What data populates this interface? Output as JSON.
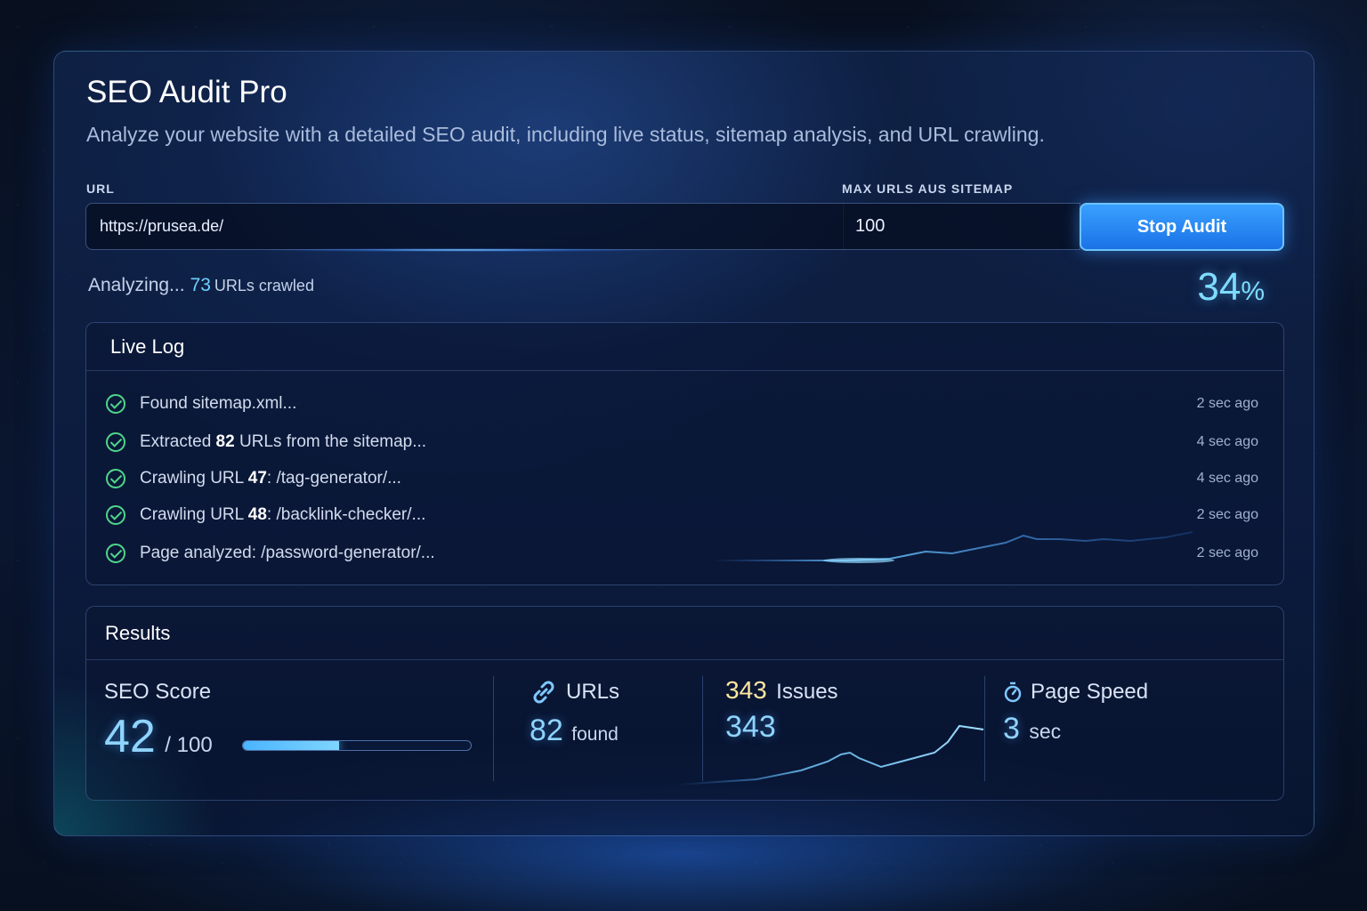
{
  "app": {
    "title": "SEO Audit Pro",
    "subtitle": "Analyze your website with a detailed SEO audit, including live status, sitemap analysis, and URL crawling."
  },
  "form": {
    "url_label": "URL",
    "url_value": "https://prusea.de/",
    "max_label": "MAX URLS AUS SITEMAP",
    "max_value": "100",
    "stop_label": "Stop Audit"
  },
  "status": {
    "prefix": "Analyzing...",
    "count": "73",
    "suffix": "URLs crawled",
    "percent_number": "34",
    "percent_sign": "%",
    "progress": 0.34
  },
  "log": {
    "title": "Live Log",
    "entries": [
      {
        "pre": "Found sitemap.xml...",
        "bold": "",
        "post": "",
        "time": "2 sec ago"
      },
      {
        "pre": "Extracted ",
        "bold": "82",
        "post": " URLs from the sitemap...",
        "time": "4 sec ago"
      },
      {
        "pre": "Crawling URL ",
        "bold": "47",
        "post": ": /tag-generator/...",
        "time": "4 sec ago"
      },
      {
        "pre": "Crawling URL ",
        "bold": "48",
        "post": ": /backlink-checker/...",
        "time": "2 sec ago"
      },
      {
        "pre": "Page analyzed: /password-generator/...",
        "bold": "",
        "post": "",
        "time": "2 sec ago"
      }
    ]
  },
  "results": {
    "title": "Results",
    "seo_score": {
      "label": "SEO Score",
      "value": "42",
      "max": "/ 100",
      "fraction": 0.42
    },
    "urls": {
      "label": "URLs",
      "value": "82",
      "unit": "found"
    },
    "issues": {
      "count_label": "343",
      "label": "Issues",
      "value": "343"
    },
    "page_speed": {
      "label": "Page Speed",
      "value": "3",
      "unit": "sec"
    }
  },
  "icons": {
    "check": "check-circle-icon",
    "link": "link-icon",
    "speed": "stopwatch-icon"
  },
  "colors": {
    "accent": "#3aa0ff",
    "success": "#4fd58a",
    "highlight": "#7fdcff"
  }
}
